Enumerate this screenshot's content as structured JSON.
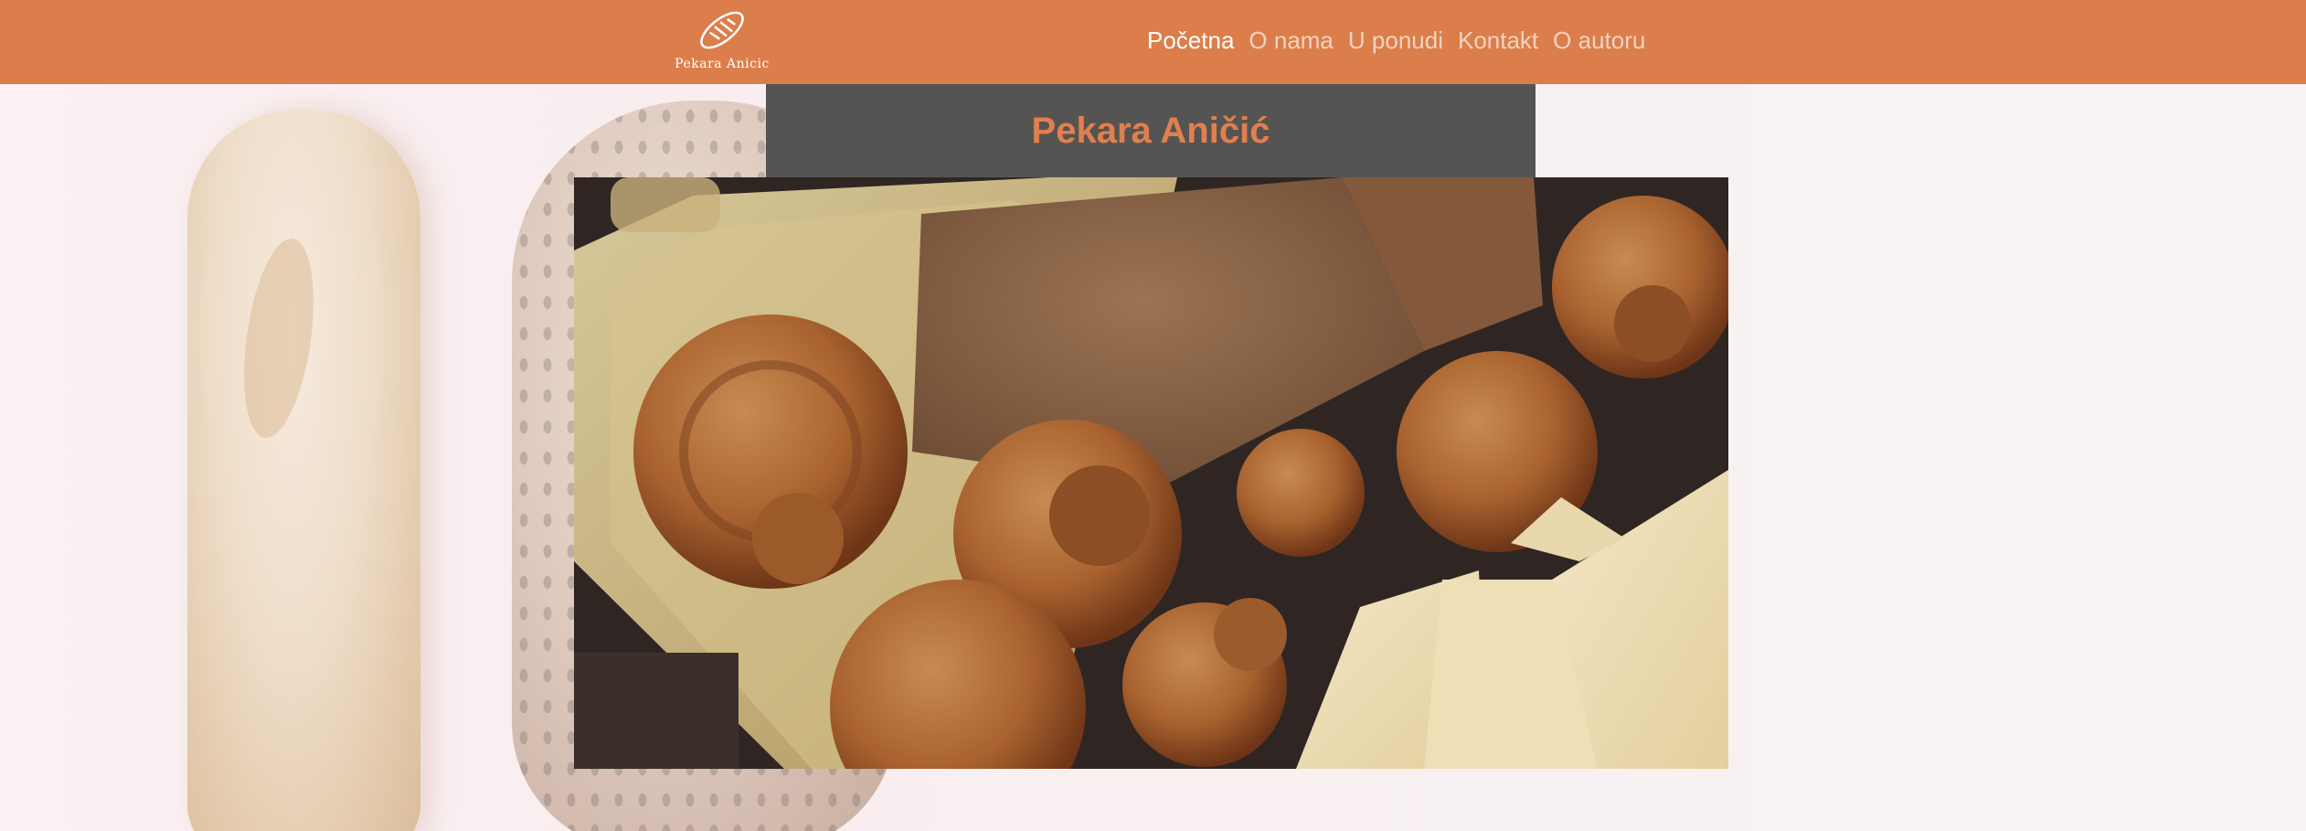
{
  "header": {
    "logo_text": "Pekara Anicic",
    "nav": [
      {
        "label": "Početna",
        "active": true
      },
      {
        "label": "O nama",
        "active": false
      },
      {
        "label": "U ponudi",
        "active": false
      },
      {
        "label": "Kontakt",
        "active": false
      },
      {
        "label": "O autoru",
        "active": false
      }
    ]
  },
  "banner": {
    "title": "Pekara Aničić"
  },
  "icons": {
    "logo": "bread-loaf-icon"
  },
  "colors": {
    "header_bg": "#db7e4b",
    "banner_bg": "#565453",
    "title": "#e0804e",
    "nav_active": "#ffffff",
    "nav_inactive": "#f3d3bf"
  }
}
